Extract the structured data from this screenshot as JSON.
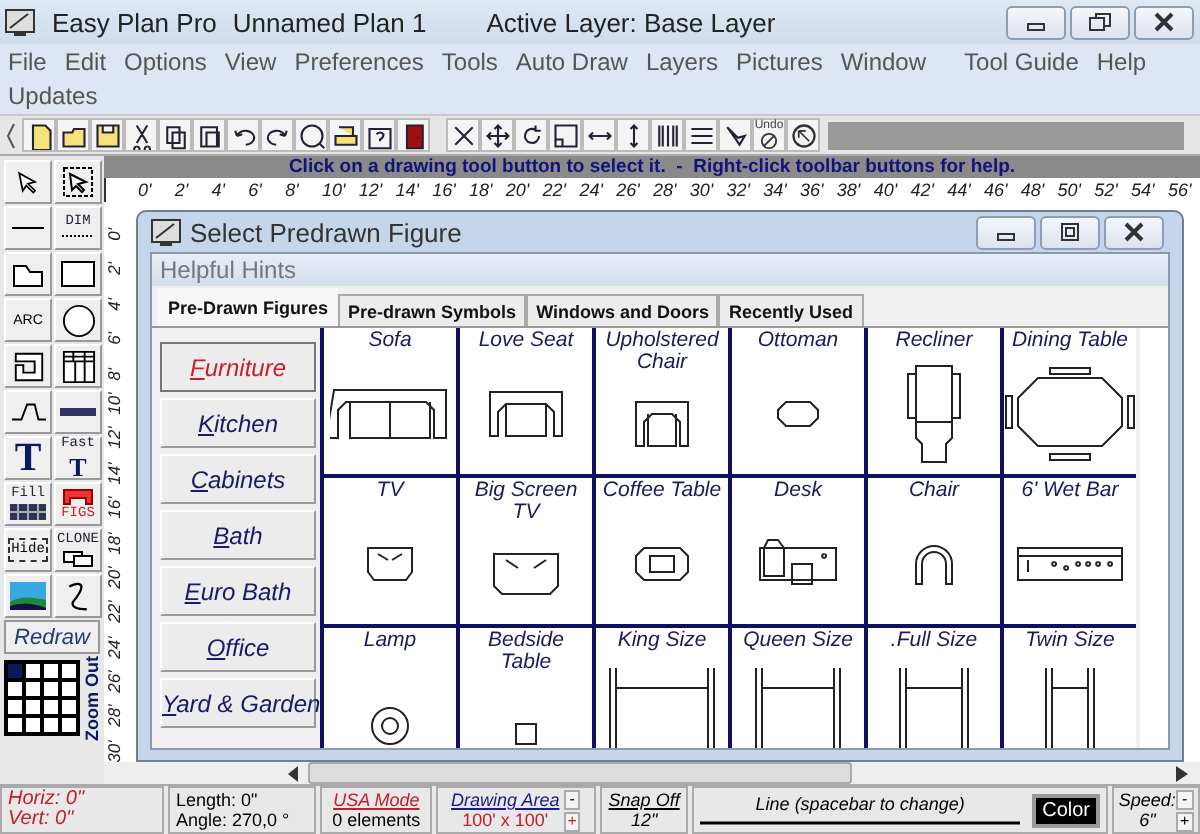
{
  "window": {
    "title": "Easy Plan Pro",
    "document": "Unnamed Plan 1",
    "layer": "Active Layer: Base Layer"
  },
  "menu_rows": [
    [
      "File",
      "Edit",
      "Options",
      "View",
      "Preferences",
      "Tools",
      "Auto Draw",
      "Layers",
      "Pictures",
      "Window",
      "Tool Guide",
      "Help"
    ],
    [
      "Updates"
    ]
  ],
  "toolbar": {
    "undo_label": "Undo"
  },
  "hint_bar": "Click on a drawing tool button to select it.  -  Right-click toolbar buttons for help.",
  "ruler_h": [
    "0'",
    "2'",
    "4'",
    "6'",
    "8'",
    "10'",
    "12'",
    "14'",
    "16'",
    "18'",
    "20'",
    "22'",
    "24'",
    "26'",
    "28'",
    "30'",
    "32'",
    "34'",
    "36'",
    "38'",
    "40'",
    "42'",
    "44'",
    "46'",
    "48'",
    "50'",
    "52'",
    "54'",
    "56'"
  ],
  "ruler_v": [
    "0'",
    "2'",
    "4'",
    "6'",
    "8'",
    "10'",
    "12'",
    "14'",
    "16'",
    "18'",
    "20'",
    "22'",
    "24'",
    "26'",
    "28'",
    "30'"
  ],
  "palette": {
    "dim": "DIM",
    "arc": "ARC",
    "text_t": "T",
    "fast": "Fast",
    "fast_t": "T",
    "fill": "Fill",
    "figs": "FIGS",
    "hide": "Hide",
    "clone": "CLONE",
    "redraw": "Redraw",
    "zoom_out": "Zoom Out"
  },
  "dialog": {
    "title": "Select Predrawn Figure",
    "hints": "Helpful Hints",
    "tabs": [
      {
        "label": "Pre-Drawn Figures",
        "selected": true
      },
      {
        "label": "Pre-drawn Symbols",
        "selected": false
      },
      {
        "label": "Windows and Doors",
        "selected": false
      },
      {
        "label": "Recently Used",
        "selected": false
      }
    ],
    "categories": [
      {
        "label": "Furniture",
        "selected": true
      },
      {
        "label": "Kitchen",
        "selected": false
      },
      {
        "label": "Cabinets",
        "selected": false
      },
      {
        "label": "Bath",
        "selected": false
      },
      {
        "label": "Euro Bath",
        "selected": false
      },
      {
        "label": "Office",
        "selected": false
      },
      {
        "label": "Yard & Garden",
        "selected": false
      }
    ],
    "figures": [
      {
        "label": "Sofa"
      },
      {
        "label": "Love Seat"
      },
      {
        "label": "Upholstered Chair"
      },
      {
        "label": "Ottoman"
      },
      {
        "label": "Recliner"
      },
      {
        "label": "Dining Table"
      },
      {
        "label": "TV"
      },
      {
        "label": "Big Screen TV"
      },
      {
        "label": "Coffee Table"
      },
      {
        "label": "Desk"
      },
      {
        "label": "Chair"
      },
      {
        "label": "6' Wet Bar"
      },
      {
        "label": "Lamp"
      },
      {
        "label": "Bedside Table"
      },
      {
        "label": "King Size"
      },
      {
        "label": "Queen Size"
      },
      {
        "label": ".Full Size"
      },
      {
        "label": "Twin Size"
      }
    ]
  },
  "status": {
    "horiz": "Horiz: 0\"",
    "vert": "Vert: 0\"",
    "length": "Length:  0\"",
    "angle": "Angle:  270,0 °",
    "mode": "USA Mode",
    "elements": "0 elements",
    "area_label": "Drawing Area",
    "area_value": "100' x 100'",
    "minus": "-",
    "plus": "+",
    "snap": "Snap Off",
    "snap_value": "12\"",
    "line": "Line  (spacebar to change)",
    "color_label": "Color",
    "speed": "Speed:",
    "speed_value": "6\"",
    "speed_minus": "-",
    "speed_plus": "+"
  }
}
